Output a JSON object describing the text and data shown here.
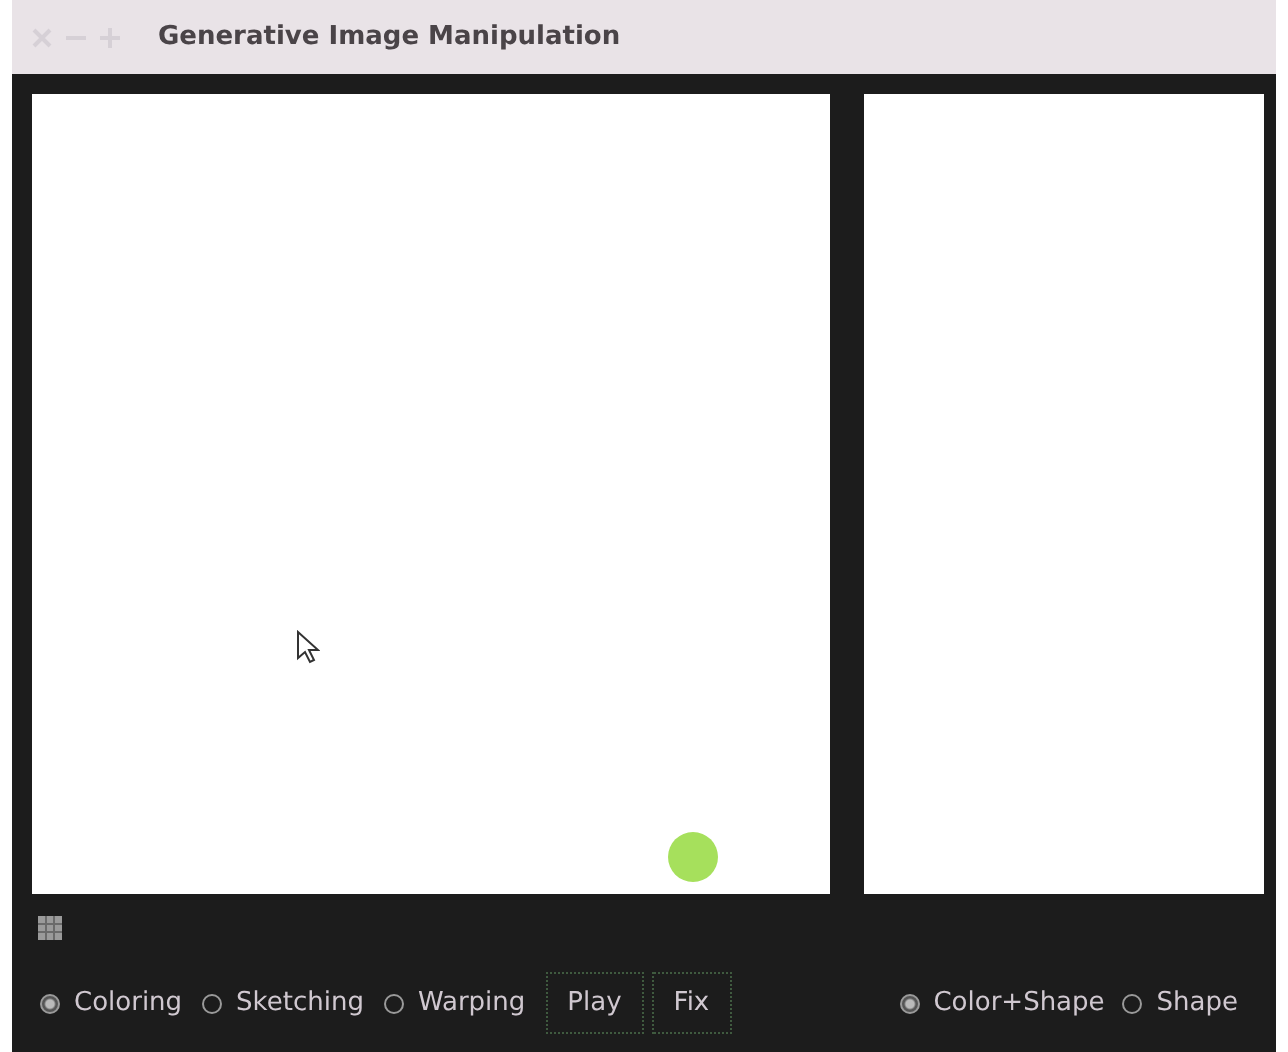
{
  "window": {
    "title": "Generative Image Manipulation"
  },
  "modes": [
    {
      "label": "Coloring",
      "selected": true
    },
    {
      "label": "Sketching",
      "selected": false
    },
    {
      "label": "Warping",
      "selected": false
    }
  ],
  "buttons": [
    "Play",
    "Fix"
  ],
  "views": [
    {
      "label": "Color+Shape",
      "selected": true
    },
    {
      "label": "Shape",
      "selected": false
    }
  ]
}
